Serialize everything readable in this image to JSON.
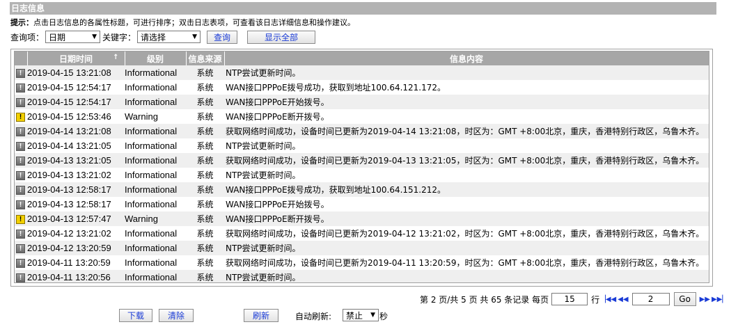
{
  "section_title": "日志信息",
  "tip": {
    "label": "提示：",
    "text": "点击日志信息的各属性标题，可进行排序；双击日志表项，可查看该日志详细信息和操作建议。"
  },
  "query": {
    "field_label": "查询项：",
    "field_value": "日期",
    "keyword_label": "关键字：",
    "keyword_value": "请选择",
    "search_label": "查询",
    "show_all_label": "显示全部"
  },
  "table": {
    "columns": {
      "datetime": "日期时间",
      "sort_indicator": "↑",
      "level": "级别",
      "source": "信息来源",
      "content": "信息内容"
    },
    "rows": [
      {
        "type": "info",
        "datetime": "2019-04-15 13:21:08",
        "level": "Informational",
        "source": "系统",
        "content": "NTP尝试更新时间。"
      },
      {
        "type": "info",
        "datetime": "2019-04-15 12:54:17",
        "level": "Informational",
        "source": "系统",
        "content": "WAN接口PPPoE拨号成功，获取到地址100.64.121.172。"
      },
      {
        "type": "info",
        "datetime": "2019-04-15 12:54:17",
        "level": "Informational",
        "source": "系统",
        "content": "WAN接口PPPoE开始拨号。"
      },
      {
        "type": "warn",
        "datetime": "2019-04-15 12:53:46",
        "level": "Warning",
        "source": "系统",
        "content": "WAN接口PPPoE断开拨号。"
      },
      {
        "type": "info",
        "datetime": "2019-04-14 13:21:08",
        "level": "Informational",
        "source": "系统",
        "content": "获取网络时间成功，设备时间已更新为2019-04-14 13:21:08，时区为：GMT +8:00北京，重庆，香港特别行政区，乌鲁木齐。"
      },
      {
        "type": "info",
        "datetime": "2019-04-14 13:21:05",
        "level": "Informational",
        "source": "系统",
        "content": "NTP尝试更新时间。"
      },
      {
        "type": "info",
        "datetime": "2019-04-13 13:21:05",
        "level": "Informational",
        "source": "系统",
        "content": "获取网络时间成功，设备时间已更新为2019-04-13 13:21:05，时区为：GMT +8:00北京，重庆，香港特别行政区，乌鲁木齐。"
      },
      {
        "type": "info",
        "datetime": "2019-04-13 13:21:02",
        "level": "Informational",
        "source": "系统",
        "content": "NTP尝试更新时间。"
      },
      {
        "type": "info",
        "datetime": "2019-04-13 12:58:17",
        "level": "Informational",
        "source": "系统",
        "content": "WAN接口PPPoE拨号成功，获取到地址100.64.151.212。"
      },
      {
        "type": "info",
        "datetime": "2019-04-13 12:58:17",
        "level": "Informational",
        "source": "系统",
        "content": "WAN接口PPPoE开始拨号。"
      },
      {
        "type": "warn",
        "datetime": "2019-04-13 12:57:47",
        "level": "Warning",
        "source": "系统",
        "content": "WAN接口PPPoE断开拨号。"
      },
      {
        "type": "info",
        "datetime": "2019-04-12 13:21:02",
        "level": "Informational",
        "source": "系统",
        "content": "获取网络时间成功，设备时间已更新为2019-04-12 13:21:02，时区为：GMT +8:00北京，重庆，香港特别行政区，乌鲁木齐。"
      },
      {
        "type": "info",
        "datetime": "2019-04-12 13:20:59",
        "level": "Informational",
        "source": "系统",
        "content": "NTP尝试更新时间。"
      },
      {
        "type": "info",
        "datetime": "2019-04-11 13:20:59",
        "level": "Informational",
        "source": "系统",
        "content": "获取网络时间成功，设备时间已更新为2019-04-11 13:20:59，时区为：GMT +8:00北京，重庆，香港特别行政区，乌鲁木齐。"
      },
      {
        "type": "info",
        "datetime": "2019-04-11 13:20:56",
        "level": "Informational",
        "source": "系统",
        "content": "NTP尝试更新时间。"
      }
    ]
  },
  "pager": {
    "summary": "第 2 页/共 5 页 共 65 条记录 每页",
    "per_page": "15",
    "row_unit": "行",
    "page_input": "2",
    "go_label": "Go"
  },
  "actions": {
    "download_label": "下载",
    "clear_label": "清除",
    "refresh_label": "刷新",
    "auto_refresh_label": "自动刷新:",
    "auto_refresh_value": "禁止",
    "seconds_unit": "秒"
  },
  "icons": {
    "info": "info-icon",
    "warn": "warning-icon",
    "first": "first-page-icon",
    "prev": "prev-page-icon",
    "next": "next-page-icon",
    "last": "last-page-icon"
  },
  "colors": {
    "header_bg": "#a6a6a6",
    "title_bg": "#b3b3b3",
    "link_blue": "#1a3bd6",
    "warning_yellow": "#f2d000"
  }
}
